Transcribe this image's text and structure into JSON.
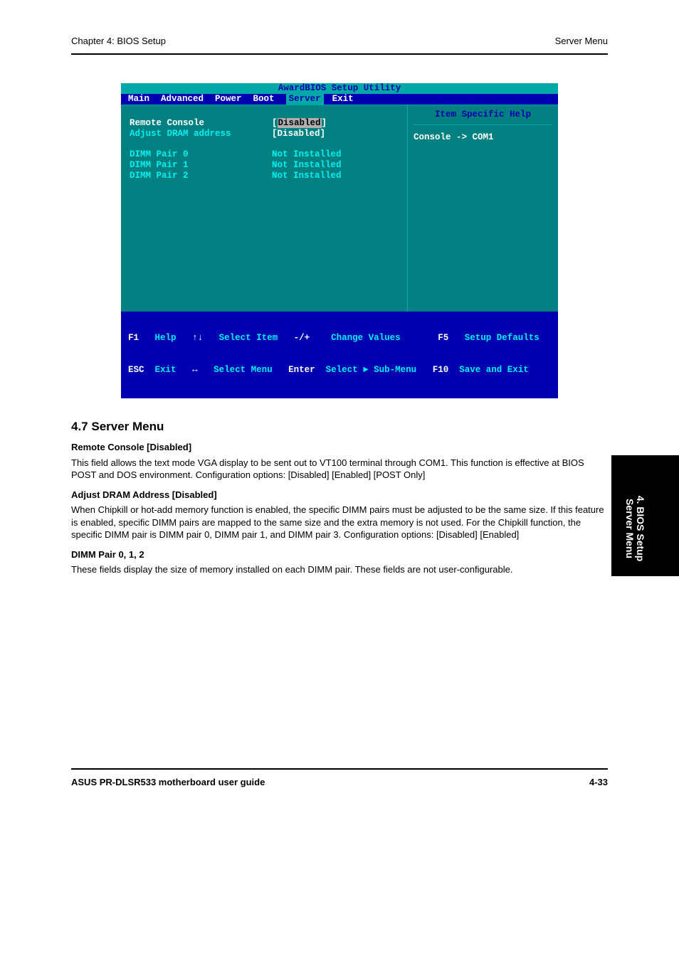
{
  "header": {
    "left": "Chapter 4: BIOS Setup",
    "right": "Server Menu"
  },
  "bios": {
    "title": "AwardBIOS Setup Utility",
    "menu": [
      "Main",
      "Advanced",
      "Power",
      "Boot",
      "Server",
      "Exit"
    ],
    "active_menu": "Server",
    "settings": [
      {
        "label": "Remote Console",
        "value_prefix": "[",
        "value_hl": "Disabled",
        "value_suffix": "]",
        "label_white": true,
        "value_white": true,
        "highlight": true
      },
      {
        "label": "Adjust DRAM address",
        "value_plain": "[Disabled]",
        "label_white": false,
        "value_white": true
      }
    ],
    "dimms": [
      {
        "label": "DIMM Pair 0",
        "value": "Not Installed"
      },
      {
        "label": "DIMM Pair 1",
        "value": "Not Installed"
      },
      {
        "label": "DIMM Pair 2",
        "value": "Not Installed"
      }
    ],
    "help_title": "Item Specific Help",
    "help_body": "Console -> COM1",
    "footer_line1": {
      "f1": "F1",
      "help": "Help",
      "arrv": "↑↓",
      "sel_item": "Select Item",
      "pm": "-/+",
      "chg": "Change Values",
      "f5": "F5",
      "def": "Setup Defaults"
    },
    "footer_line2": {
      "esc": "ESC",
      "exit": "Exit",
      "arrh": "↔",
      "sel_menu": "Select Menu",
      "enter": "Enter",
      "sub": "Select ► Sub-Menu",
      "f10": "F10",
      "save": "Save and Exit"
    }
  },
  "section_title": "4.7  Server Menu",
  "settings_text": [
    {
      "title": "Remote Console [Disabled]",
      "body": "This field allows the text mode VGA display to be sent out to VT100 terminal through COM1. This function is effective at BIOS POST and DOS environment. Configuration options: [Disabled] [Enabled] [POST Only]"
    },
    {
      "title": "Adjust DRAM Address [Disabled]",
      "body": "When Chipkill or hot-add memory function is enabled, the specific DIMM pairs must be adjusted to be the same size. If this feature is enabled, specific DIMM pairs are mapped to the same size and the extra memory is not used. For the Chipkill function, the specific DIMM pair is DIMM pair 0, DIMM pair 1, and DIMM pair 3. Configuration options: [Disabled] [Enabled]"
    },
    {
      "title": "DIMM Pair 0, 1, 2",
      "body": "These fields display the size of memory installed on each DIMM pair. These fields are not user-configurable."
    }
  ],
  "side_tab": {
    "line1": "4. BIOS Setup",
    "line2": "Server Menu"
  },
  "footer": {
    "left": "ASUS PR-DLSR533 motherboard user guide",
    "right": "4-33"
  }
}
